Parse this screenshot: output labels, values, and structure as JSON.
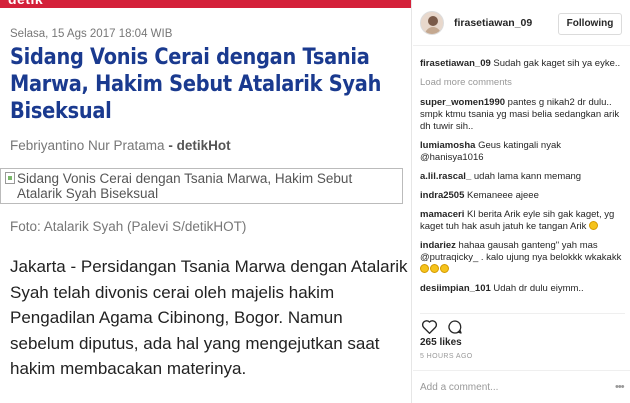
{
  "article": {
    "logo": "detik",
    "dateline": "Selasa, 15 Ags 2017 18:04 WIB",
    "headline": "Sidang Vonis Cerai dengan Tsania Marwa, Hakim Sebut Atalarik Syah Biseksual",
    "byline_author": "Febriyantino Nur Pratama",
    "byline_sep": " - ",
    "byline_source": "detikHot",
    "image_alt": "Sidang Vonis Cerai dengan Tsania Marwa, Hakim Sebut Atalarik Syah Biseksual",
    "caption": "Foto: Atalarik Syah (Palevi S/detikHOT)",
    "body": "Jakarta - Persidangan Tsania Marwa dengan Atalarik Syah telah divonis cerai oleh majelis hakim Pengadilan Agama Cibinong, Bogor. Namun sebelum diputus, ada hal yang mengejutkan saat hakim membacakan materinya."
  },
  "instagram": {
    "username": "firasetiawan_09",
    "follow_label": "Following",
    "load_more": "Load more comments",
    "comments": [
      {
        "user": "firasetiawan_09",
        "text": "Sudah gak kaget sih ya eyke..",
        "emojis": 0
      },
      {
        "user": "super_women1990",
        "text": "pantes g nikah2 dr dulu.. smpk ktmu tsania yg masi belia sedangkan arik dh tuwir sih..",
        "emojis": 0
      },
      {
        "user": "lumiamosha",
        "text": "Geus katingali nyak @hanisya1016",
        "emojis": 0
      },
      {
        "user": "a.lil.rascal_",
        "text": "udah lama kann memang",
        "emojis": 0
      },
      {
        "user": "indra2505",
        "text": "Kemaneee ajeee",
        "emojis": 0
      },
      {
        "user": "mamaceri",
        "text": "Kl berita Arik eyle sih gak kaget, yg kaget tuh hak asuh jatuh ke tangan Arik",
        "emojis": 1
      },
      {
        "user": "indariez",
        "text": "hahaa gausah ganteng\" yah mas @putraqicky_ . kalo ujung nya belokkk wkakakk",
        "emojis": 3
      },
      {
        "user": "desiimpian_101",
        "text": "Udah dr dulu eiymm..",
        "emojis": 0
      }
    ],
    "likes": "265 likes",
    "time": "5 HOURS AGO",
    "add_comment_placeholder": "Add a comment...",
    "more_label": "•••"
  }
}
